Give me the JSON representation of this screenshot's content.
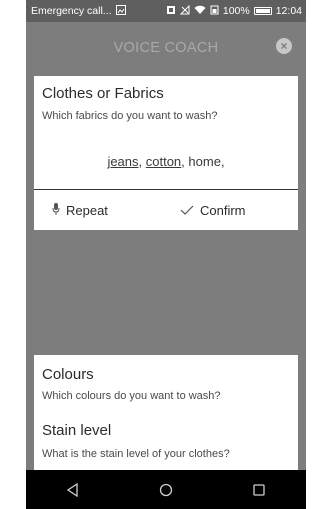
{
  "status_bar": {
    "notification": "Emergency call...",
    "battery": "100%",
    "time": "12:04"
  },
  "header": {
    "title": "VOICE COACH",
    "close_icon": "close-icon"
  },
  "question_card": {
    "title": "Clothes or Fabrics",
    "subtitle": "Which fabrics do you want to wash?",
    "answers": [
      "jeans",
      "cotton",
      "home"
    ],
    "repeat_label": "Repeat",
    "confirm_label": "Confirm",
    "repeat_icon": "microphone-icon",
    "confirm_icon": "check-icon"
  },
  "upcoming": [
    {
      "title": "Colours",
      "subtitle": "Which colours do you want to wash?"
    },
    {
      "title": "Stain level",
      "subtitle": "What is the stain level of your clothes?"
    }
  ],
  "nav": {
    "back_icon": "back-triangle-icon",
    "home_icon": "home-circle-icon",
    "recents_icon": "recents-square-icon"
  }
}
